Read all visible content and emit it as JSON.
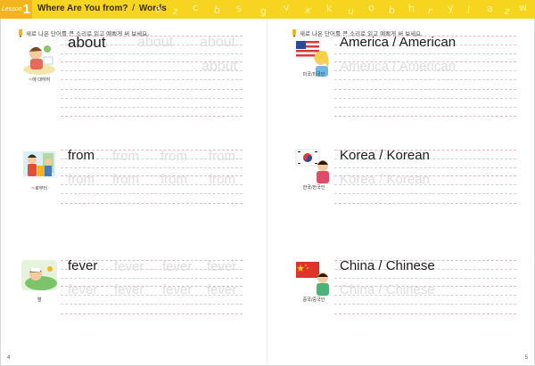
{
  "header": {
    "lesson_label": "Lesson",
    "lesson_number": "1",
    "title": "Where Are You from?",
    "title_sep": "/",
    "section": "Words",
    "deco_letters": [
      "a",
      "z",
      "c",
      "b",
      "s",
      "g",
      "v",
      "x",
      "k",
      "u",
      "o",
      "b",
      "h",
      "r",
      "y",
      "l",
      "a",
      "z",
      "w",
      "y"
    ]
  },
  "instruction": "새로 나온 단어를 큰 소리로 읽고 예쁘게 써 보세요.",
  "left_page": {
    "page_number": "4",
    "words": [
      {
        "word": "about",
        "caption": "~에 대하여",
        "trace": [
          "about",
          "about",
          "about"
        ],
        "icon": "about-illustration"
      },
      {
        "word": "from",
        "caption": "~로부터",
        "trace": [
          "from",
          "from",
          "from",
          "from",
          "from",
          "from",
          "from"
        ],
        "icon": "from-illustration"
      },
      {
        "word": "fever",
        "caption": "열",
        "trace": [
          "fever",
          "fever",
          "fever",
          "fever",
          "fever",
          "fever",
          "fever"
        ],
        "icon": "fever-illustration"
      }
    ]
  },
  "right_page": {
    "page_number": "5",
    "words": [
      {
        "word": "America / American",
        "caption": "미국/미국인",
        "trace": [
          "America / American"
        ],
        "icon": "us-flag-illustration"
      },
      {
        "word": "Korea / Korean",
        "caption": "한국/한국인",
        "trace": [
          "Korea / Korean"
        ],
        "icon": "korea-flag-illustration"
      },
      {
        "word": "China / Chinese",
        "caption": "중국/중국인",
        "trace": [
          "China / Chinese"
        ],
        "icon": "china-flag-illustration"
      }
    ]
  }
}
